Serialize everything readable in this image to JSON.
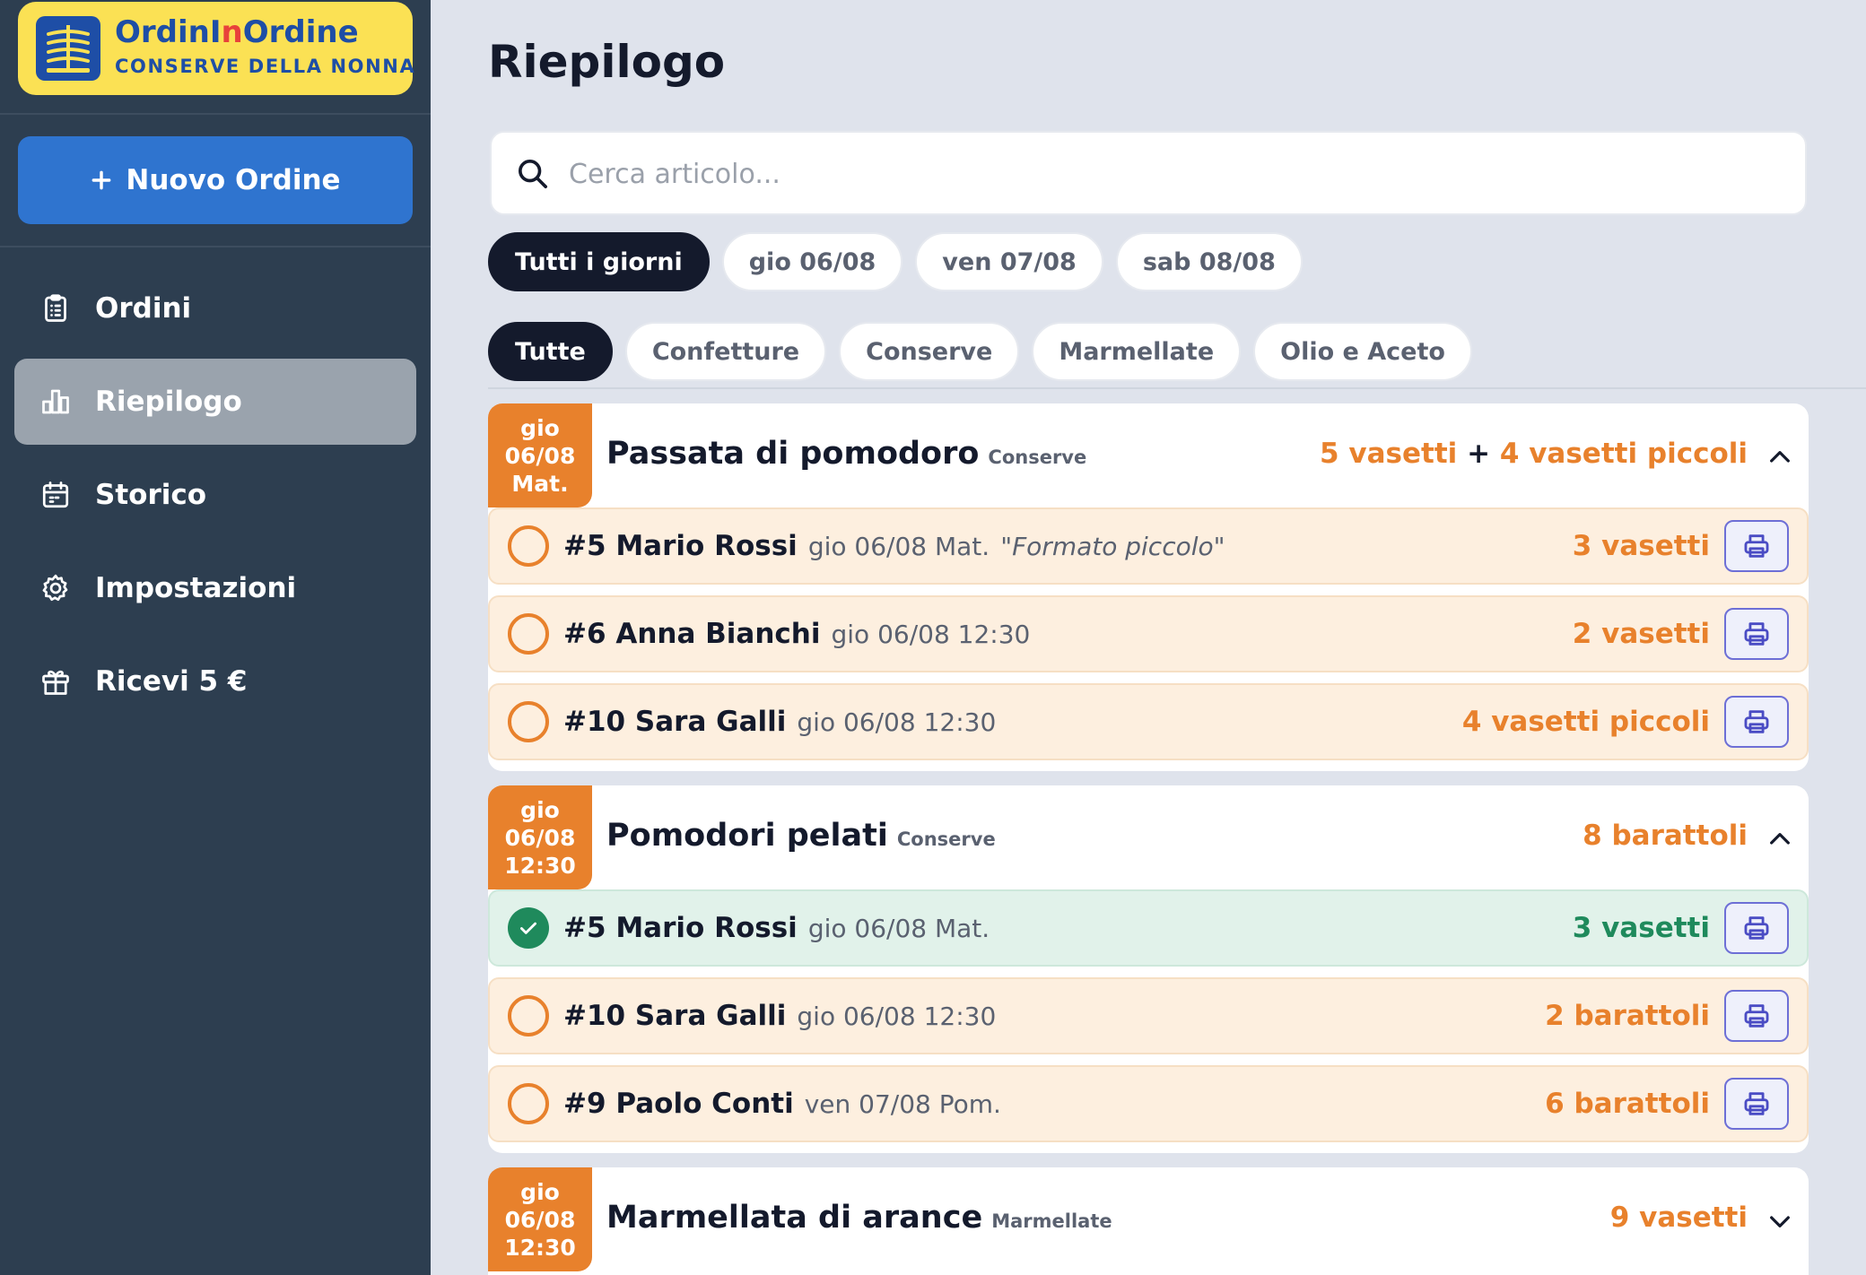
{
  "app": {
    "brand_prefix": "OrdinI",
    "brand_highlight": "n",
    "brand_suffix": "Ordine",
    "brand_sub": "CONSERVE DELLA NONNA",
    "new_order_label": "Nuovo Ordine"
  },
  "nav": {
    "orders": "Ordini",
    "summary": "Riepilogo",
    "history": "Storico",
    "settings": "Impostazioni",
    "referral": "Ricevi 5 €"
  },
  "page": {
    "title": "Riepilogo",
    "search_placeholder": "Cerca articolo..."
  },
  "day_filters": [
    "Tutti i giorni",
    "gio 06/08",
    "ven 07/08",
    "sab 08/08"
  ],
  "category_filters": [
    "Tutte",
    "Confetture",
    "Conserve",
    "Marmellate",
    "Olio e Aceto"
  ],
  "products": [
    {
      "badge": [
        "gio",
        "06/08",
        "Mat."
      ],
      "name": "Passata di pomodoro",
      "category": "Conserve",
      "total_a": "5 vasetti",
      "plus": "+",
      "total_b": "4 vasetti piccoli",
      "expanded": true,
      "orders": [
        {
          "id": "#5 Mario Rossi",
          "when": "gio 06/08 Mat.",
          "note": "\"Formato piccolo\"",
          "qty": "3 vasetti",
          "done": false
        },
        {
          "id": "#6 Anna Bianchi",
          "when": "gio 06/08 12:30",
          "note": "",
          "qty": "2 vasetti",
          "done": false
        },
        {
          "id": "#10 Sara Galli",
          "when": "gio 06/08 12:30",
          "note": "",
          "qty": "4 vasetti piccoli",
          "done": false
        }
      ]
    },
    {
      "badge": [
        "gio",
        "06/08",
        "12:30"
      ],
      "name": "Pomodori pelati",
      "category": "Conserve",
      "total_a": "8 barattoli",
      "expanded": true,
      "orders": [
        {
          "id": "#5 Mario Rossi",
          "when": "gio 06/08 Mat.",
          "note": "",
          "qty": "3 vasetti",
          "done": true
        },
        {
          "id": "#10 Sara Galli",
          "when": "gio 06/08 12:30",
          "note": "",
          "qty": "2 barattoli",
          "done": false
        },
        {
          "id": "#9 Paolo Conti",
          "when": "ven 07/08 Pom.",
          "note": "",
          "qty": "6 barattoli",
          "done": false
        }
      ]
    },
    {
      "badge": [
        "gio",
        "06/08",
        "12:30"
      ],
      "name": "Marmellata di arance",
      "category": "Marmellate",
      "total_a": "9 vasetti",
      "expanded": false,
      "orders": []
    }
  ],
  "colors": {
    "sidebar": "#2d3e50",
    "accent": "#2f74cf",
    "brand_yellow": "#fbe154",
    "orange": "#e8812c",
    "green": "#1f8a5c",
    "print": "#6d6fd6"
  }
}
